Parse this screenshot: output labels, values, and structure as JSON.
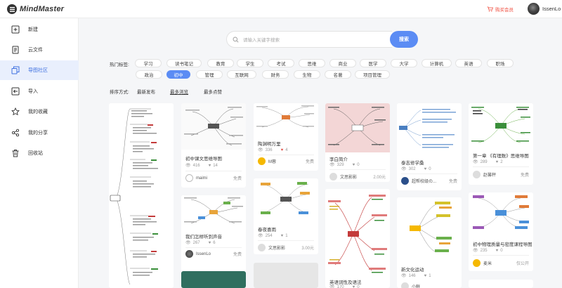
{
  "brand": {
    "name": "MindMaster"
  },
  "topbar": {
    "vip_label": "购买会员",
    "username": "IssenLo"
  },
  "sidebar": {
    "items": [
      {
        "label": "新建",
        "icon": "plus-square-icon"
      },
      {
        "label": "云文件",
        "icon": "document-icon"
      },
      {
        "label": "导图社区",
        "icon": "copy-icon",
        "active": true
      },
      {
        "label": "导入",
        "icon": "import-icon"
      },
      {
        "label": "我的收藏",
        "icon": "star-icon"
      },
      {
        "label": "我的分享",
        "icon": "share-icon"
      },
      {
        "label": "回收站",
        "icon": "trash-icon"
      }
    ]
  },
  "search": {
    "placeholder": "请输入关键字搜索",
    "button": "搜索"
  },
  "tags": {
    "label": "热门标签:",
    "items": [
      "学习",
      "读书笔记",
      "教育",
      "学生",
      "考试",
      "思维",
      "商业",
      "医学",
      "大学",
      "计算机",
      "英语",
      "职场",
      "政治",
      "初中",
      "管理",
      "互联网",
      "财务",
      "生物",
      "名著",
      "项目管理"
    ],
    "active": "初中"
  },
  "sort": {
    "label": "排序方式:",
    "options": [
      "最新发布",
      "最多浏览",
      "最多点赞"
    ],
    "active": "最多浏览"
  },
  "cards": [
    {
      "title": "",
      "author": "",
      "views": "",
      "likes": "",
      "price": ""
    },
    {
      "title": "初中课文思维导图",
      "views": "416",
      "likes": "14",
      "author": "maimi",
      "price": "免费"
    },
    {
      "title": "陶渊明万里",
      "views": "336",
      "likes": "4",
      "author": "M蓉",
      "price": "免费"
    },
    {
      "title": "李白简介",
      "views": "329",
      "likes": "0",
      "author": "文思影影",
      "price": "2.00元"
    },
    {
      "title": "泰志修学桑",
      "views": "302",
      "likes": "0",
      "author": "超帮校级の...",
      "price": "免费"
    },
    {
      "title": "第一章 《有理数》思维导图",
      "views": "289",
      "likes": "2",
      "author": "赵馨秤",
      "price": "免费"
    },
    {
      "title": "我们怎样听到声音",
      "views": "267",
      "likes": "6",
      "author": "IssenLo",
      "price": "免费"
    },
    {
      "title": "春夜喜雨",
      "views": "254",
      "likes": "1",
      "author": "文思影影",
      "price": "3.00元"
    },
    {
      "title": "英语词性及语法",
      "views": "170",
      "likes": "0",
      "author": "",
      "price": ""
    },
    {
      "title": "新文化运动",
      "views": "146",
      "likes": "1",
      "author": "小鲜",
      "price": ""
    },
    {
      "title": "初中物理质量与密度课程导图",
      "views": "235",
      "likes": "0",
      "author": "麦米",
      "price": "仅公开"
    }
  ],
  "colors": {
    "accent": "#5b8cf4",
    "vip": "#f04b3c",
    "like": "#e0534a"
  }
}
